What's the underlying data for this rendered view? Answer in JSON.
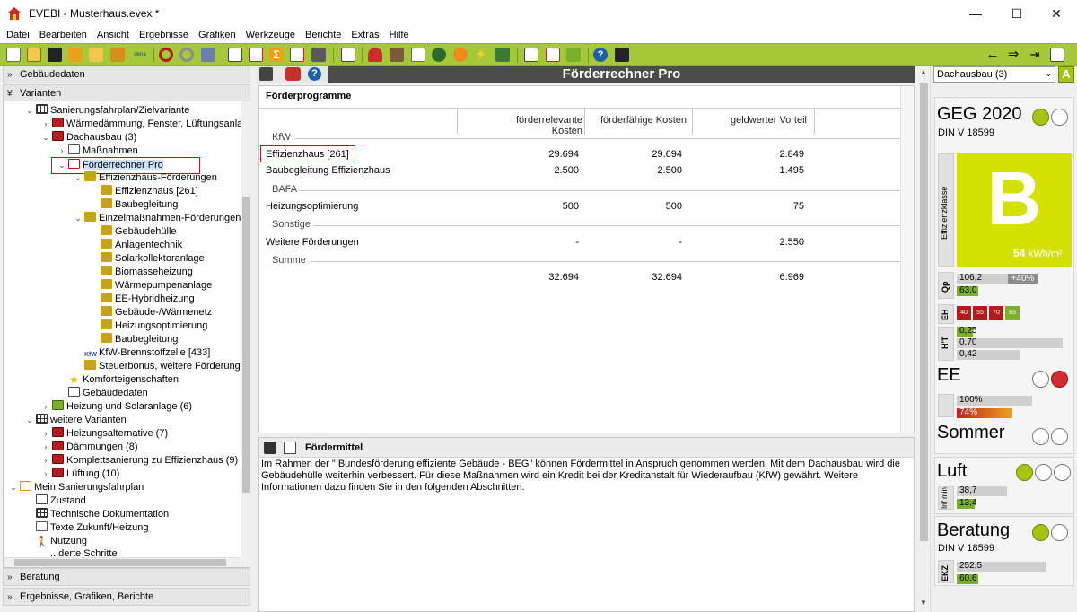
{
  "window": {
    "app_name": "EVEBI",
    "title": "EVEBI  - Musterhaus.evex *",
    "minimize": "—",
    "maximize": "☐",
    "close": "✕"
  },
  "menu": [
    "Datei",
    "Bearbeiten",
    "Ansicht",
    "Ergebnisse",
    "Grafiken",
    "Werkzeuge",
    "Berichte",
    "Extras",
    "Hilfe"
  ],
  "toolbar": {
    "dena_label": "dena",
    "right_icons": [
      "arrow-left",
      "arrow-right",
      "export",
      "chart"
    ]
  },
  "left": {
    "section_top": "Gebäudedaten",
    "section_variants": "Varianten",
    "section_beratung": "Beratung",
    "section_results": "Ergebnisse, Grafiken, Berichte",
    "tree": [
      "Sanierungsfahrplan/Zielvariante",
      "Wärmedämmung, Fenster, Lüftungsanla",
      "Dachausbau (3)",
      "Maßnahmen",
      "Förderrechner Pro",
      "Effizienzhaus-Förderungen",
      "Effizienzhaus [261]",
      "Baubegleitung",
      "Einzelmaßnahmen-Förderungen",
      "Gebäudehülle",
      "Anlagentechnik",
      "Solarkollektoranlage",
      "Biomasseheizung",
      "Wärmepumpenanlage",
      "EE-Hybridheizung",
      "Gebäude-/Wärmenetz",
      "Heizungsoptimierung",
      "Baubegleitung",
      "KfW-Brennstoffzelle [433]",
      "Steuerbonus, weitere Förderung",
      "Komforteigenschaften",
      "Gebäudedaten",
      "Heizung und Solaranlage (6)",
      "weitere Varianten",
      "Heizungsalternative (7)",
      "Dämmungen (8)",
      "Komplettsanierung zu Effizienzhaus (9)",
      "Lüftung (10)",
      "Mein Sanierungsfahrplan",
      "Zustand",
      "Technische Dokumentation",
      "Texte Zukunft/Heizung",
      "Nutzung",
      "...derte Schritte"
    ],
    "kfw_badge": "KfW"
  },
  "center": {
    "header": "Förderrechner Pro",
    "panel_title": "Förderprogramme",
    "columns": [
      "förderrelevante Kosten",
      "förderfähige Kosten",
      "geldwerter Vorteil"
    ],
    "groups": {
      "kfw": "KfW",
      "bafa": "BAFA",
      "sonstige": "Sonstige",
      "summe": "Summe"
    },
    "rows": [
      {
        "label": "Effizienzhaus [261]",
        "relevant": "29.694",
        "faehig": "29.694",
        "vorteil": "2.849"
      },
      {
        "label": "Baubegleitung Effizienzhaus",
        "relevant": "2.500",
        "faehig": "2.500",
        "vorteil": "1.495"
      },
      {
        "label": "Heizungsoptimierung",
        "relevant": "500",
        "faehig": "500",
        "vorteil": "75"
      },
      {
        "label": "Weitere Förderungen",
        "relevant": "-",
        "faehig": "-",
        "vorteil": "2.550"
      },
      {
        "label": "",
        "relevant": "32.694",
        "faehig": "32.694",
        "vorteil": "6.969"
      }
    ],
    "foerdermittel_title": "Fördermittel",
    "foerdermittel_text": "Im Rahmen der \" Bundesförderung effiziente Gebäude - BEG\" können Fördermittel in Anspruch genommen werden. Mit dem Dachausbau wird die Gebäudehülle weiterhin verbessert. Für diese Maßnahmen wird ein Kredit bei der Kreditanstalt für Wiederaufbau (KfW) gewährt. Weitere Informationen dazu finden Sie in den folgenden Abschnitten."
  },
  "right": {
    "dropdown": "Dachausbau (3)",
    "a_button": "A",
    "geg_title": "GEG 2020",
    "geg_norm": "DIN V 18599",
    "effizienz_label": "Effizienzklasse",
    "effizienz_class": "B",
    "effizienz_value": "54",
    "effizienz_unit": "kWh/m²",
    "qp_label": "Qp",
    "qp_values": [
      "106,2",
      "+40%",
      "63,0"
    ],
    "eh_label": "EH",
    "eh_values": [
      "40",
      "55",
      "70",
      "85"
    ],
    "ht_label": "H'T",
    "ht_values": [
      "0,25",
      "0,70",
      "0,42"
    ],
    "ee_title": "EE",
    "ee_values": [
      "100%",
      "74%"
    ],
    "sommer_title": "Sommer",
    "luft_title": "Luft",
    "luft_label": "Inf min",
    "luft_values": [
      "38,7",
      "13,4"
    ],
    "beratung_title": "Beratung",
    "beratung_norm": "DIN V 18599",
    "ekz_label": "EKZ",
    "ekz_values": [
      "252,5",
      "60,6"
    ],
    "colors": {
      "accent_green": "#a6c412",
      "class_yellow": "#d4e000",
      "red": "#d22b2b"
    }
  }
}
